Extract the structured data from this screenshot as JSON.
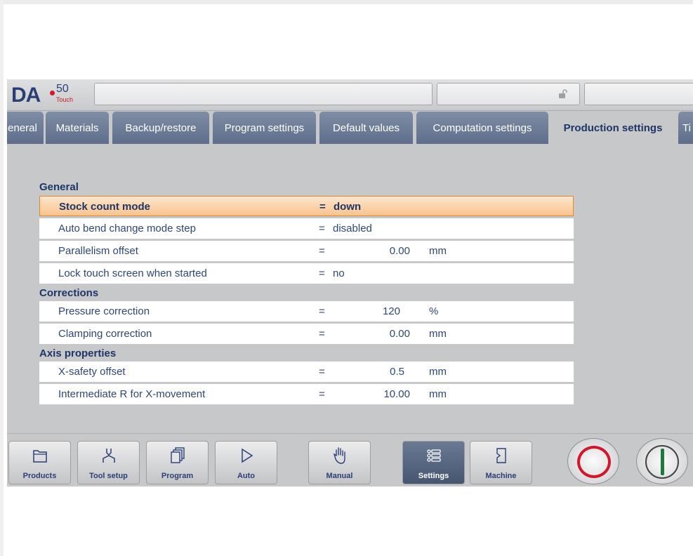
{
  "logo": {
    "brand": "DA",
    "model": "50",
    "variant": "Touch"
  },
  "header": {
    "lock_icon": "lock-open-icon"
  },
  "tabs": [
    {
      "label": "eneral",
      "active": false
    },
    {
      "label": "Materials",
      "active": false
    },
    {
      "label": "Backup/restore",
      "active": false
    },
    {
      "label": "Program settings",
      "active": false
    },
    {
      "label": "Default values",
      "active": false
    },
    {
      "label": "Computation settings",
      "active": false
    },
    {
      "label": "Production settings",
      "active": true
    },
    {
      "label": "Ti",
      "active": false
    }
  ],
  "sections": {
    "general": {
      "title": "General",
      "rows": [
        {
          "label": "Stock count mode",
          "eq": "=",
          "value": "down"
        },
        {
          "label": "Auto bend change mode step",
          "eq": "=",
          "value": "disabled"
        },
        {
          "label": "Parallelism offset",
          "eq": "=",
          "value": "0.00",
          "unit": "mm"
        },
        {
          "label": "Lock touch screen when started",
          "eq": "=",
          "value": "no"
        }
      ]
    },
    "corrections": {
      "title": "Corrections",
      "rows": [
        {
          "label": "Pressure correction",
          "eq": "=",
          "value": "120",
          "unit": "%"
        },
        {
          "label": "Clamping correction",
          "eq": "=",
          "value": "0.00",
          "unit": "mm"
        }
      ]
    },
    "axis": {
      "title": "Axis properties",
      "rows": [
        {
          "label": "X-safety offset",
          "eq": "=",
          "value": "0.5",
          "unit": "mm"
        },
        {
          "label": "Intermediate R for X-movement",
          "eq": "=",
          "value": "10.00",
          "unit": "mm"
        }
      ]
    }
  },
  "nav": {
    "products": "Products",
    "tool_setup": "Tool setup",
    "program": "Program",
    "auto": "Auto",
    "manual": "Manual",
    "settings": "Settings",
    "machine": "Machine"
  },
  "colors": {
    "accent_navy": "#1d3567",
    "tab_blue": "#6a7995",
    "selected_row": "#f8c48f",
    "stop_red": "#d3162b",
    "start_green": "#1c7b3a"
  }
}
